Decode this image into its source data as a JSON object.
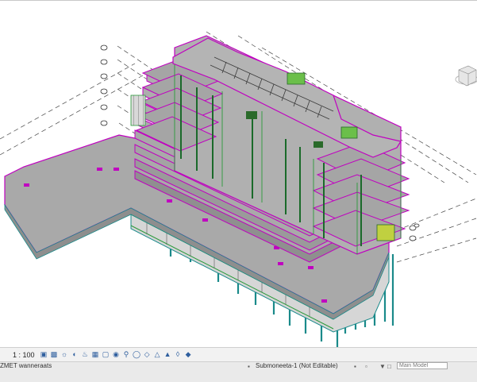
{
  "view_controls": {
    "scale": "1 : 100",
    "icons": [
      "detail-level-icon",
      "visual-style-icon",
      "sun-path-icon",
      "shadows-icon",
      "render-icon",
      "crop-view-icon",
      "show-crop-icon",
      "lock-view-icon",
      "temp-hide-icon",
      "reveal-hidden-icon",
      "worksharing-display-icon",
      "analytical-model-icon",
      "highlight-displacement-icon",
      "reveal-constraints-icon",
      "show-hidden-icon"
    ]
  },
  "status_bar": {
    "status_text": "ZMET wanneraats",
    "active_workset": "Submoneeta-1 (Not Editable)",
    "model": "Main Model"
  },
  "colors": {
    "slab": "#a8a8a8",
    "edge": "#c000c0",
    "structure": "#2a9a3a",
    "column": "#1a8a8a",
    "grid": "#444444"
  },
  "viewcube": {
    "icon": "viewcube-icon"
  }
}
